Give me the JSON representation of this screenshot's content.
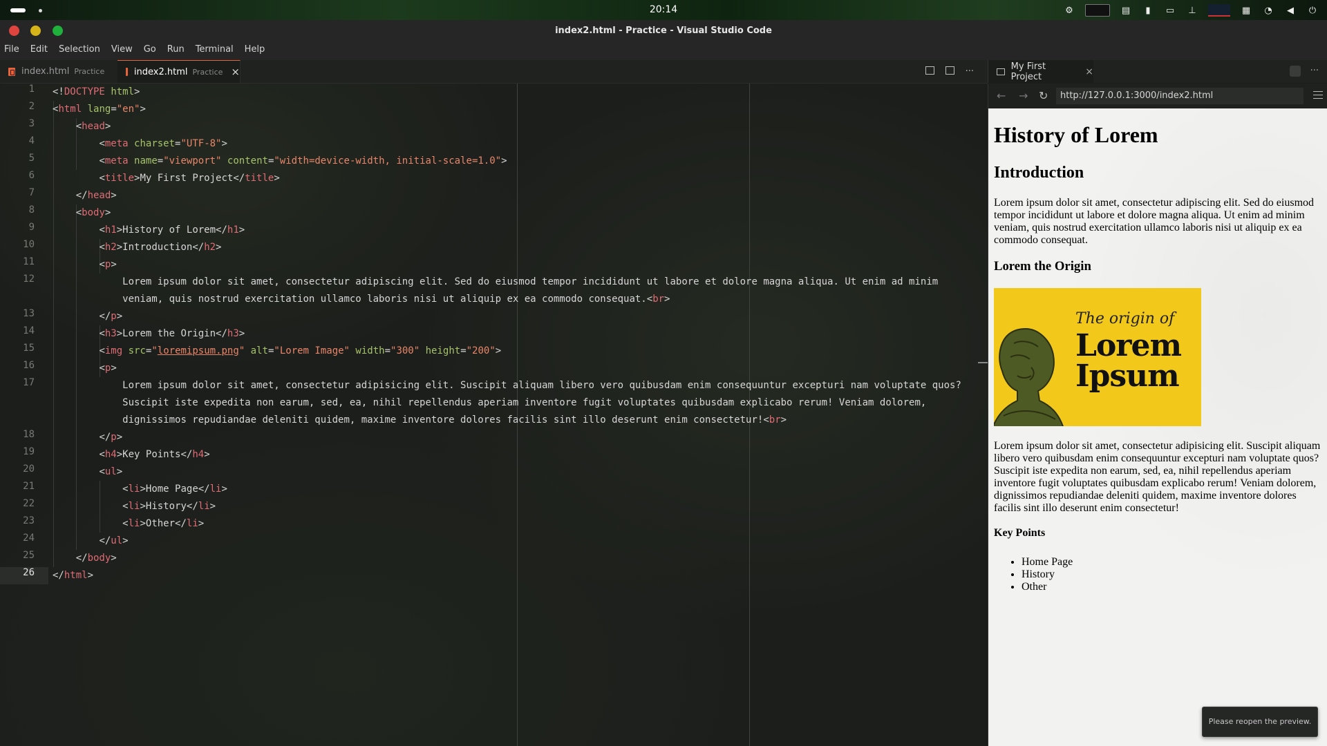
{
  "system_bar": {
    "clock": "20:14"
  },
  "window": {
    "title": "index2.html - Practice - Visual Studio Code"
  },
  "menu": [
    "File",
    "Edit",
    "Selection",
    "View",
    "Go",
    "Run",
    "Terminal",
    "Help"
  ],
  "editor_tabs": [
    {
      "name": "index.html",
      "folder": "Practice",
      "active": false
    },
    {
      "name": "index2.html",
      "folder": "Practice",
      "active": true,
      "close": "×"
    }
  ],
  "editor": {
    "active_line": 26,
    "line_numbers": [
      "1",
      "2",
      "3",
      "4",
      "5",
      "6",
      "7",
      "8",
      "9",
      "10",
      "11",
      "12",
      "13",
      "14",
      "15",
      "16",
      "17",
      "18",
      "19",
      "20",
      "21",
      "22",
      "23",
      "24",
      "25",
      "26"
    ],
    "lines": {
      "l1_doctype": "<!DOCTYPE html>",
      "l12a": "Lorem ipsum dolor sit amet, consectetur adipiscing elit. Sed do eiusmod tempor incididunt ut labore et dolore magna aliqua. Ut enim ad minim",
      "l12b": "veniam, quis nostrud exercitation ullamco laboris nisi ut aliquip ex ea commodo consequat.",
      "l17a": "Lorem ipsum dolor sit amet, consectetur adipisicing elit. Suscipit aliquam libero vero quibusdam enim consequuntur excepturi nam voluptate quos?",
      "l17b": "Suscipit iste expedita non earum, sed, ea, nihil repellendus aperiam inventore fugit voluptates quibusdam explicabo rerum! Veniam dolorem,",
      "l17c": "dignissimos repudiandae deleniti quidem, maxime inventore dolores facilis sint illo deserunt enim consectetur!"
    }
  },
  "preview": {
    "tab_title": "My First Project",
    "tab_close": "×",
    "url": "http://127.0.0.1:3000/index2.html",
    "h1": "History of Lorem",
    "h2": "Introduction",
    "p1": "Lorem ipsum dolor sit amet, consectetur adipiscing elit. Sed do eiusmod tempor incididunt ut labore et dolore magna aliqua. Ut enim ad minim veniam, quis nostrud exercitation ullamco laboris nisi ut aliquip ex ea commodo consequat.",
    "h3": "Lorem the Origin",
    "image": {
      "line1": "The origin of",
      "line2": "Lorem",
      "line3": "Ipsum",
      "bg": "#f2c81b"
    },
    "p2": "Lorem ipsum dolor sit amet, consectetur adipisicing elit. Suscipit aliquam libero vero quibusdam enim consequuntur excepturi nam voluptate quos? Suscipit iste expedita non earum, sed, ea, nihil repellendus aperiam inventore fugit voluptates quibusdam explicabo rerum! Veniam dolorem, dignissimos repudiandae deleniti quidem, maxime inventore dolores facilis sint illo deserunt enim consectetur!",
    "h4": "Key Points",
    "list": [
      "Home Page",
      "History",
      "Other"
    ]
  },
  "toast": "Please reopen the preview.",
  "colors": {
    "accent": "#e8633a",
    "tag": "#e06c75",
    "attr": "#a6c36b",
    "string": "#e9866a"
  }
}
